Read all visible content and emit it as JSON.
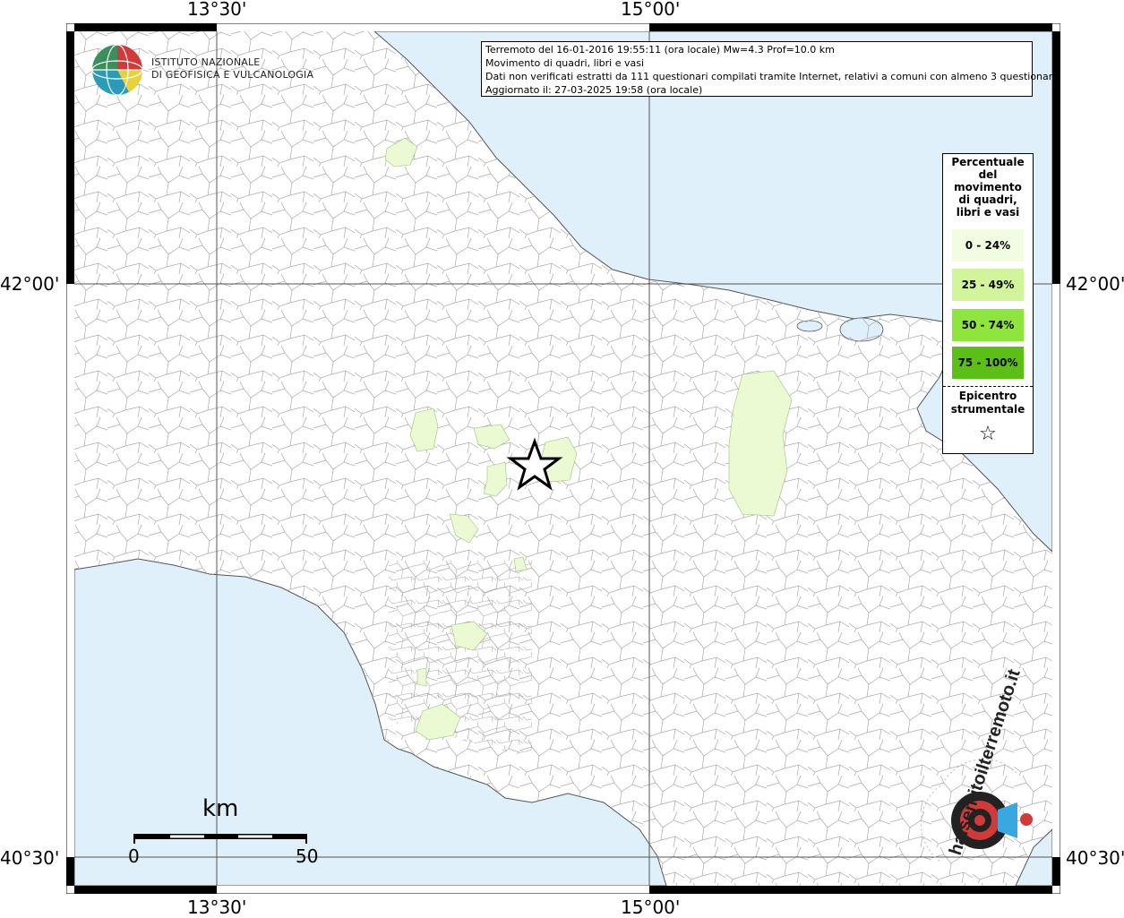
{
  "graticule": {
    "top_labels": [
      "13°30'",
      "15°00'"
    ],
    "bottom_labels": [
      "13°30'",
      "15°00'"
    ],
    "left_labels": [
      "42°00'",
      "40°30'"
    ],
    "right_labels": [
      "42°00'",
      "40°30'"
    ]
  },
  "info": {
    "line1": "Terremoto del 16-01-2016 19:55:11 (ora locale) Mw=4.3 Prof=10.0 km",
    "line2": "Movimento di quadri, libri e vasi",
    "line3": "Dati non verificati estratti da 111 questionari compilati tramite Internet, relativi a comuni con almeno 3 questionari.",
    "line4": "Aggiornato il: 27-03-2025 19:58 (ora locale)"
  },
  "logo": {
    "line1": "ISTITUTO NAZIONALE",
    "line2": "DI GEOFISICA E VULCANOLOGIA",
    "icon": "ingv-globe-icon"
  },
  "legend": {
    "title_lines": [
      "Percentuale",
      "del",
      "movimento",
      "di quadri,",
      "libri e vasi"
    ],
    "classes": [
      {
        "label": "0 - 24%",
        "color": "#f0fde0"
      },
      {
        "label": "25 - 49%",
        "color": "#d2f59c"
      },
      {
        "label": "50 - 74%",
        "color": "#8ee53c"
      },
      {
        "label": "75 - 100%",
        "color": "#5cbf16"
      }
    ],
    "epicenter_lines": [
      "Epicentro",
      "strumentale"
    ],
    "epicenter_symbol": "☆"
  },
  "scale": {
    "unit": "km",
    "start": "0",
    "end": "50"
  },
  "watermark": {
    "text": "haisentitoilterremoto.it",
    "icon": "megaphone-target-icon"
  },
  "colors": {
    "sea": "#dff0fb",
    "land": "#ffffff",
    "affected_low": "#ebfad2",
    "border": "#9e9e9e"
  }
}
